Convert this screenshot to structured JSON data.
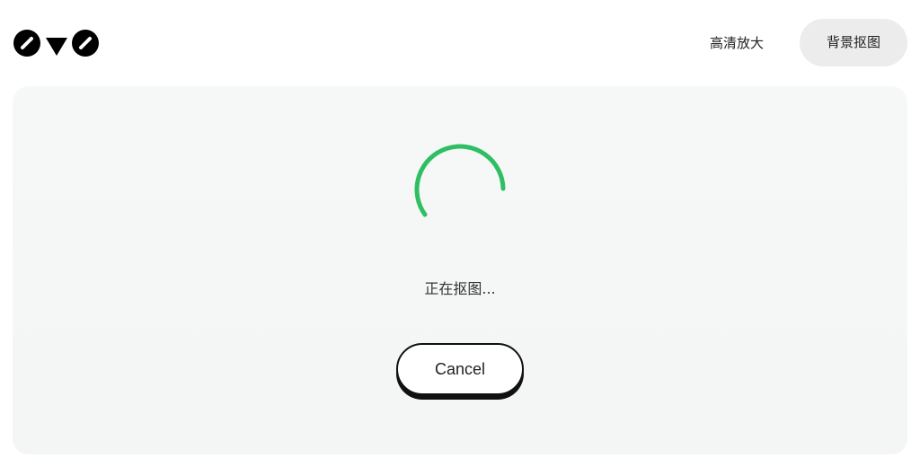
{
  "header": {
    "logo_icon": "owo-logo-icon",
    "nav_upscale_label": "高清放大",
    "nav_bg_remove_label": "背景抠图"
  },
  "main": {
    "spinner_icon": "loading-spinner-icon",
    "spinner_color": "#2fbf63",
    "status_text": "正在抠图...",
    "cancel_label": "Cancel"
  }
}
